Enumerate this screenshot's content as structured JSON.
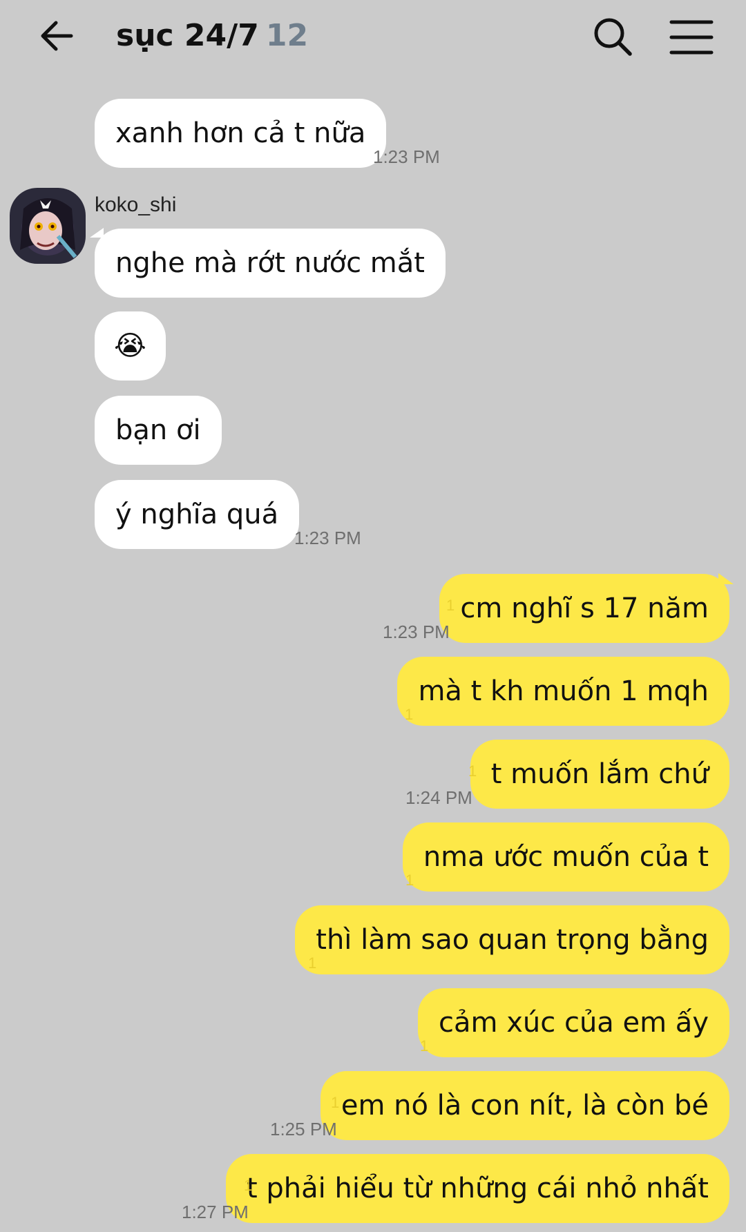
{
  "header": {
    "title": "sục 24/7",
    "member_count": "12",
    "back_icon": "arrow-left-icon",
    "search_icon": "search-icon",
    "menu_icon": "hamburger-menu-icon"
  },
  "incoming": {
    "first": {
      "text": "xanh hơn cả t nữa",
      "time": "1:23 PM"
    },
    "sender": "koko_shi",
    "messages": [
      "nghe mà rớt nước mắt",
      "😭",
      "bạn ơi",
      "ý nghĩa quá"
    ],
    "last_time": "1:23 PM"
  },
  "outgoing": [
    {
      "text": "cm nghĩ s 17 năm",
      "unread": "1",
      "time": "1:23 PM"
    },
    {
      "text": "mà t kh muốn 1 mqh",
      "unread": "1",
      "time": ""
    },
    {
      "text": "t muốn lắm chứ",
      "unread": "1",
      "time": "1:24 PM"
    },
    {
      "text": "nma ước muốn của t",
      "unread": "1",
      "time": ""
    },
    {
      "text": "thì làm sao quan trọng bằng",
      "unread": "1",
      "time": ""
    },
    {
      "text": "cảm xúc của em ấy",
      "unread": "1",
      "time": ""
    },
    {
      "text": "em nó là con nít, là còn bé",
      "unread": "1",
      "time": "1:25 PM"
    },
    {
      "text": "t phải hiểu từ những cái nhỏ nhất",
      "unread": "1",
      "time": "1:27 PM"
    }
  ],
  "colors": {
    "background": "#cbcbcb",
    "incoming_bubble": "#ffffff",
    "outgoing_bubble": "#fde848",
    "count_color": "#6f7e8c"
  }
}
